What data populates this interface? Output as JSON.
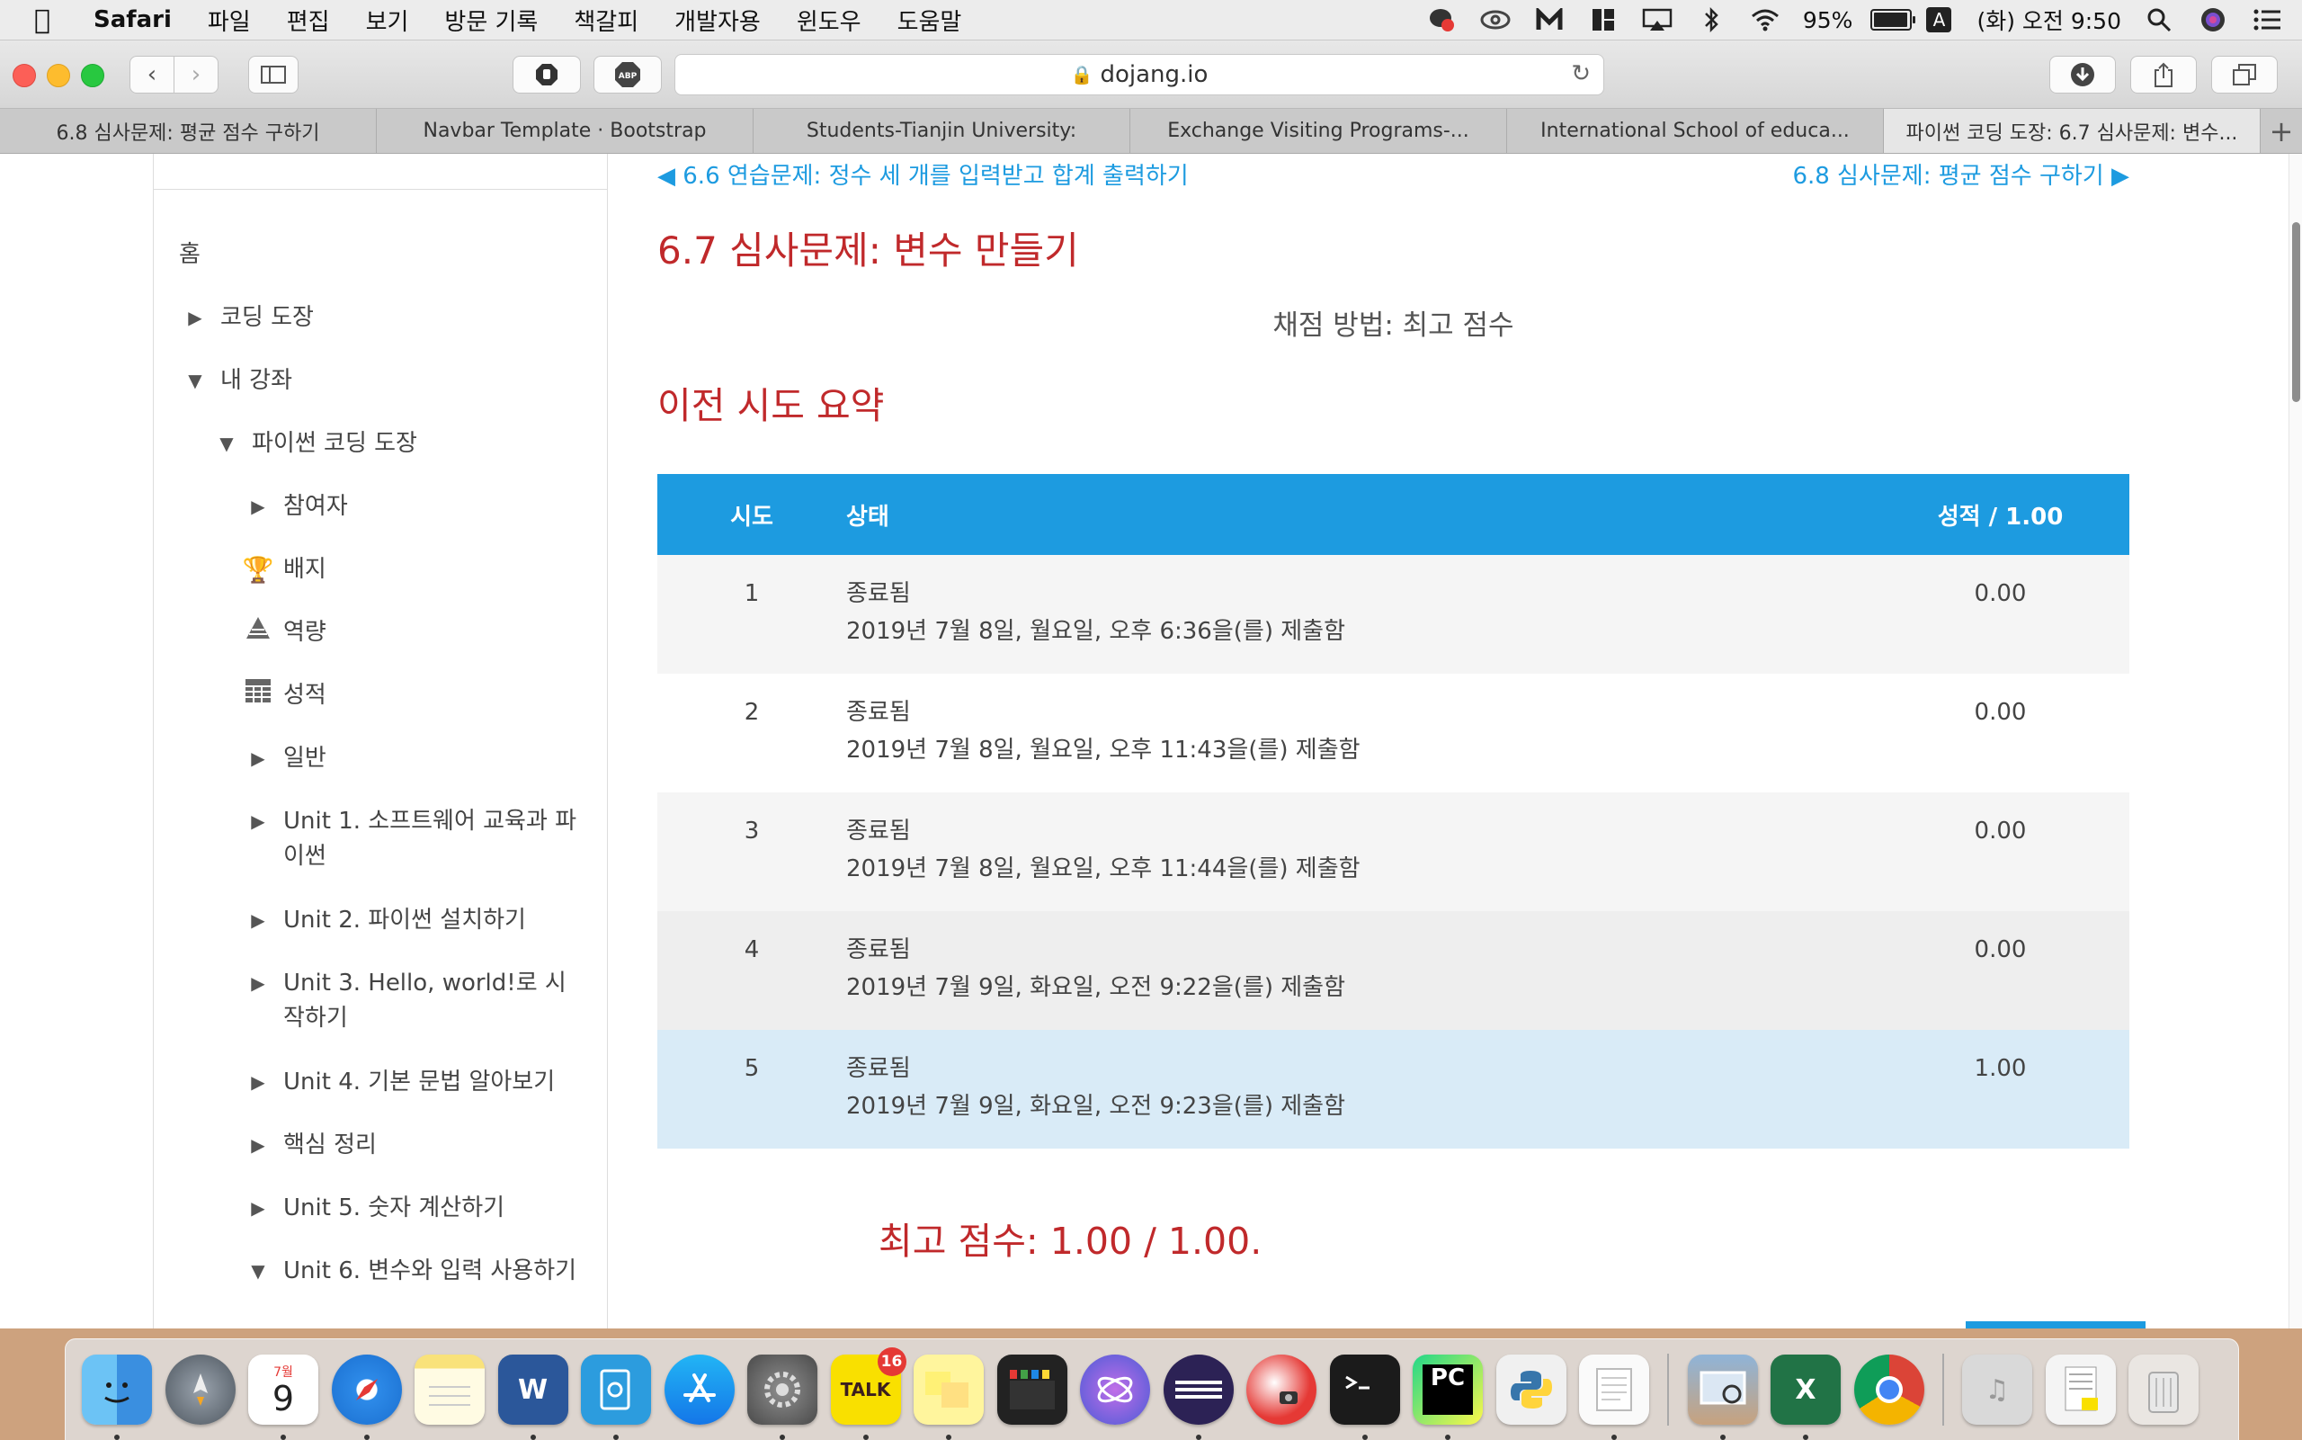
{
  "menubar": {
    "app_name": "Safari",
    "items": [
      "파일",
      "편집",
      "보기",
      "방문 기록",
      "책갈피",
      "개발자용",
      "윈도우",
      "도움말"
    ],
    "battery": "95%",
    "input_source": "A",
    "clock": "(화) 오전 9:50"
  },
  "toolbar": {
    "url": "dojang.io"
  },
  "tabs": [
    "6.8 심사문제: 평균 점수 구하기",
    "Navbar Template · Bootstrap",
    "Students-Tianjin University:",
    "Exchange Visiting Programs-...",
    "International School of educa...",
    "파이썬 코딩 도장: 6.7 심사문제: 변수..."
  ],
  "sidebar": {
    "items": [
      {
        "label": "홈"
      },
      {
        "label": "코딩 도장"
      },
      {
        "label": "내 강좌"
      },
      {
        "label": "파이썬 코딩 도장"
      },
      {
        "label": "참여자"
      },
      {
        "label": "배지"
      },
      {
        "label": "역량"
      },
      {
        "label": "성적"
      },
      {
        "label": "일반"
      },
      {
        "label": "Unit 1. 소프트웨어 교육과 파이썬"
      },
      {
        "label": "Unit 2. 파이썬 설치하기"
      },
      {
        "label": "Unit 3. Hello, world!로 시작하기"
      },
      {
        "label": "Unit 4. 기본 문법 알아보기"
      },
      {
        "label": "핵심 정리"
      },
      {
        "label": "Unit 5. 숫자 계산하기"
      },
      {
        "label": "Unit 6. 변수와 입력 사용하기"
      }
    ]
  },
  "main": {
    "prev_link": "◀ 6.6 연습문제: 정수 세 개를 입력받고 합계 출력하기",
    "next_link": "6.8 심사문제: 평균 점수 구하기 ▶",
    "title": "6.7 심사문제: 변수 만들기",
    "grading_method": "채점 방법: 최고 점수",
    "summary_title": "이전 시도 요약",
    "table": {
      "headers": [
        "시도",
        "상태",
        "성적 / 1.00"
      ],
      "rows": [
        {
          "attempt": "1",
          "state": "종료됨",
          "submitted": "2019년 7월 8일, 월요일, 오후 6:36을(를) 제출함",
          "grade": "0.00"
        },
        {
          "attempt": "2",
          "state": "종료됨",
          "submitted": "2019년 7월 8일, 월요일, 오후 11:43을(를) 제출함",
          "grade": "0.00"
        },
        {
          "attempt": "3",
          "state": "종료됨",
          "submitted": "2019년 7월 8일, 월요일, 오후 11:44을(를) 제출함",
          "grade": "0.00"
        },
        {
          "attempt": "4",
          "state": "종료됨",
          "submitted": "2019년 7월 9일, 화요일, 오전 9:22을(를) 제출함",
          "grade": "0.00"
        },
        {
          "attempt": "5",
          "state": "종료됨",
          "submitted": "2019년 7월 9일, 화요일, 오전 9:23을(를) 제출함",
          "grade": "1.00"
        }
      ]
    },
    "best_score": "최고 점수: 1.00 / 1.00."
  },
  "dock": {
    "calendar_month": "7월",
    "calendar_day": "9",
    "word_letter": "W",
    "kakaotalk_label": "TALK",
    "kakaotalk_badge": "16",
    "pycharm_label": "PC",
    "excel_letter": "X"
  }
}
